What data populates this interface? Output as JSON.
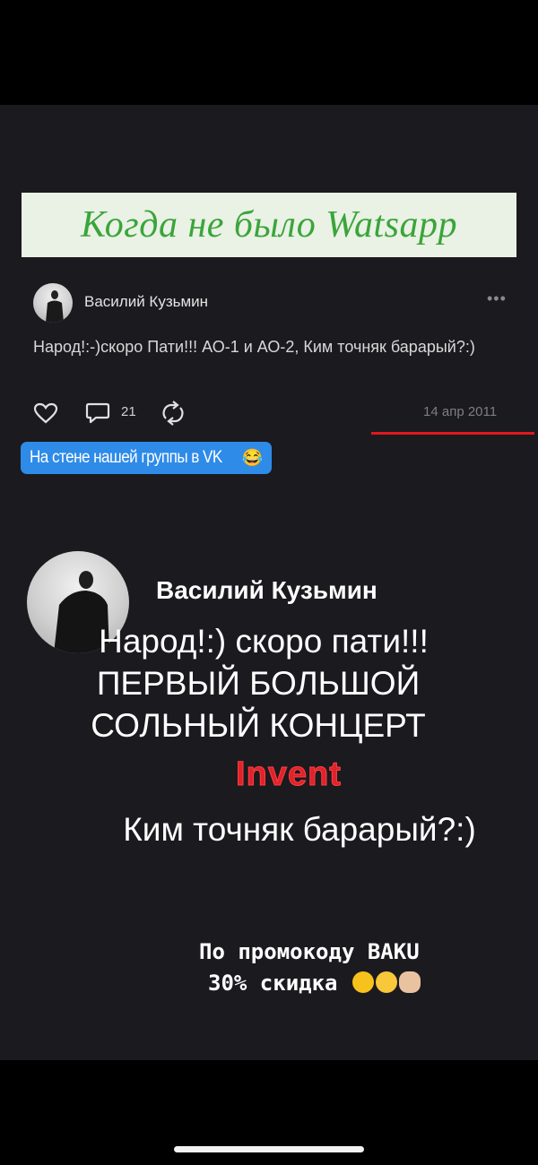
{
  "title_banner": {
    "text": "Когда не было Watsapp",
    "color": "#3aa53a"
  },
  "vk_post": {
    "author": "Василий Кузьмин",
    "menu": "•••",
    "text": "Народ!:-)скоро Пати!!! АО-1 и АО-2, Ким точняк барарый?:)",
    "comment_count": "21",
    "date": "14 апр 2011",
    "icons": [
      "heart-icon",
      "comment-icon",
      "share-icon",
      "more-icon"
    ]
  },
  "vk_tag": {
    "text": "На стене нашей группы в VK",
    "emoji": "😂"
  },
  "big_block": {
    "author": "Василий Кузьмин",
    "line1": "Народ!:) скоро пати!!!",
    "line2": "ПЕРВЫЙ БОЛЬШОЙ",
    "line3": "СОЛЬНЫЙ КОНЦЕРТ",
    "invent": "Invent",
    "line4": "Ким точняк барарый?:)"
  },
  "promo": {
    "line1": "По промокоду BAKU",
    "line2": "30% скидка",
    "emojis": [
      "😲",
      "😌",
      "👏"
    ]
  },
  "colors": {
    "story_bg": "#1b1a1f",
    "accent_red": "#e0181e",
    "tag_blue": "#2e8be8"
  }
}
